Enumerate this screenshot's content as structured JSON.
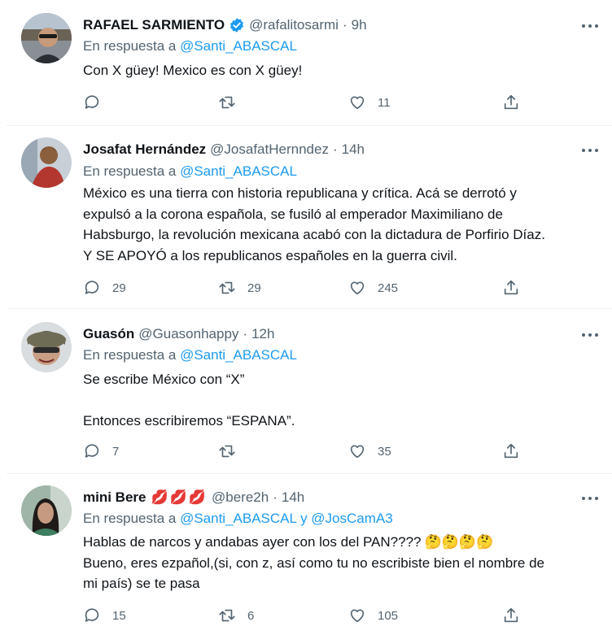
{
  "tweets": [
    {
      "name": "RAFAEL SARMIENTO",
      "handle": "@rafalitosarmi",
      "time": "9h",
      "reply_prefix": "En respuesta a ",
      "reply_mention": "@Santi_ABASCAL",
      "lines": [
        "Con X güey! Mexico es con X güey!"
      ],
      "replies": "",
      "retweets": "",
      "likes": "11",
      "verified": true
    },
    {
      "name": "Josafat Hernández",
      "handle": "@JosafatHernndez",
      "time": "14h",
      "reply_prefix": "En respuesta a ",
      "reply_mention": "@Santi_ABASCAL",
      "lines": [
        "México es una tierra con historia republicana y crítica. Acá se derrotó y",
        "expulsó a la corona española, se fusiló al emperador Maximiliano de",
        "Habsburgo, la revolución mexicana acabó con la dictadura de Porfirio Díaz.",
        "Y SE APOYÓ a los republicanos españoles en la guerra civil."
      ],
      "replies": "29",
      "retweets": "29",
      "likes": "245"
    },
    {
      "name": "Guasón",
      "handle": "@Guasonhappy",
      "time": "12h",
      "reply_prefix": "En respuesta a ",
      "reply_mention": "@Santi_ABASCAL",
      "lines": [
        "Se escribe México con “X”",
        "",
        "Entonces escribiremos “ESPANA”."
      ],
      "replies": "7",
      "retweets": "",
      "likes": "35"
    },
    {
      "name": "mini Bere",
      "name_emoji": "💋💋💋",
      "handle": "@bere2h",
      "time": "14h",
      "reply_prefix": "En respuesta a ",
      "reply_mention": "@Santi_ABASCAL",
      "reply_join": " y ",
      "reply_mention2": "@JosCamA3",
      "line1": "Hablas de narcos y andabas ayer con los del PAN????",
      "line1_emoji": "🤔🤔🤔🤔",
      "lines": [
        "Bueno, eres ezpañol,(si, con z, así como tu no escribiste bien el nombre de",
        "mi país) se te pasa"
      ],
      "replies": "15",
      "retweets": "6",
      "likes": "105"
    }
  ],
  "colors": {
    "text": "#0f1419",
    "secondary": "#536471",
    "link": "#1d9bf0",
    "divider": "#eff3f4",
    "verified": "#1d9bf0"
  },
  "icons": [
    "reply-icon",
    "retweet-icon",
    "like-icon",
    "share-icon",
    "more-icon",
    "verified-icon"
  ]
}
